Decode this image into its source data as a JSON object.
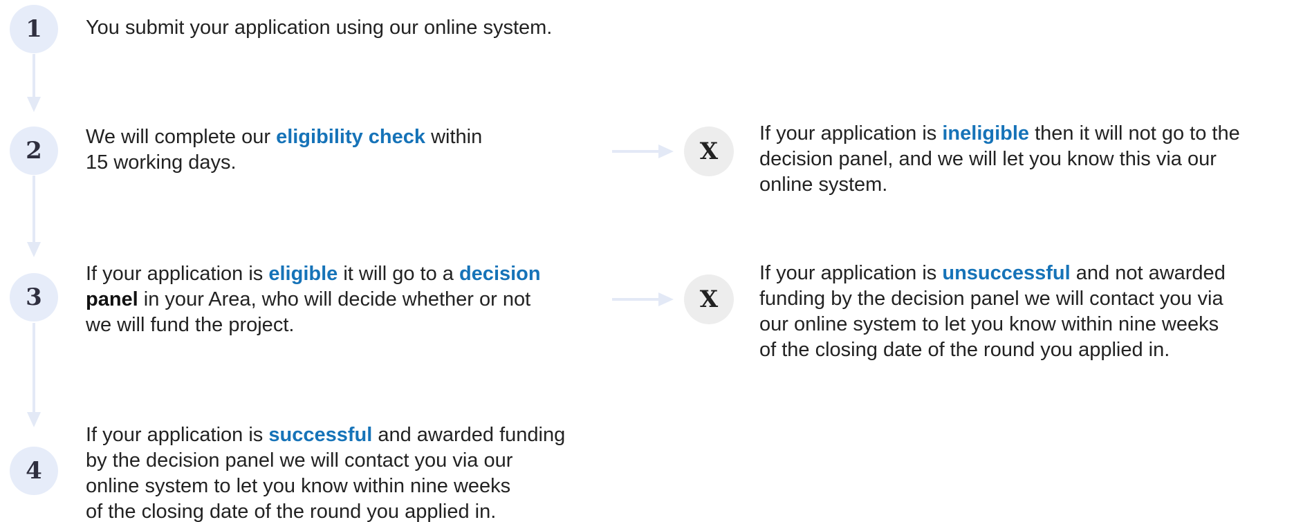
{
  "steps": [
    {
      "number": "1",
      "lines": [
        [
          {
            "t": "You submit your application using our online system.",
            "s": ""
          }
        ]
      ]
    },
    {
      "number": "2",
      "lines": [
        [
          {
            "t": "We will complete our ",
            "s": ""
          },
          {
            "t": "eligibility check",
            "s": "blue"
          },
          {
            "t": " within",
            "s": ""
          }
        ],
        [
          {
            "t": "15 working days.",
            "s": ""
          }
        ]
      ]
    },
    {
      "number": "3",
      "lines": [
        [
          {
            "t": "If your application is ",
            "s": ""
          },
          {
            "t": "eligible",
            "s": "blue"
          },
          {
            "t": " it will go to a ",
            "s": ""
          },
          {
            "t": "decision",
            "s": "blue"
          }
        ],
        [
          {
            "t": "panel",
            "s": "bold"
          },
          {
            "t": " in your Area, who will decide whether or not",
            "s": ""
          }
        ],
        [
          {
            "t": "we will fund the project.",
            "s": ""
          }
        ]
      ]
    },
    {
      "number": "4",
      "lines": [
        [
          {
            "t": "If your application is ",
            "s": ""
          },
          {
            "t": "successful",
            "s": "blue"
          },
          {
            "t": " and awarded funding",
            "s": ""
          }
        ],
        [
          {
            "t": "by the decision panel we will contact you via our",
            "s": ""
          }
        ],
        [
          {
            "t": "online system to let you know within nine weeks",
            "s": ""
          }
        ],
        [
          {
            "t": "of the closing date of the round you applied in.",
            "s": ""
          }
        ]
      ]
    }
  ],
  "outcomes": [
    {
      "symbol": "X",
      "lines": [
        [
          {
            "t": "If your application is ",
            "s": ""
          },
          {
            "t": "ineligible",
            "s": "blue"
          },
          {
            "t": " then it will not go to the",
            "s": ""
          }
        ],
        [
          {
            "t": "decision panel, and we will let you know this via our",
            "s": ""
          }
        ],
        [
          {
            "t": "online system.",
            "s": ""
          }
        ]
      ]
    },
    {
      "symbol": "X",
      "lines": [
        [
          {
            "t": "If your application is ",
            "s": ""
          },
          {
            "t": "unsuccessful",
            "s": "blue"
          },
          {
            "t": " and not awarded",
            "s": ""
          }
        ],
        [
          {
            "t": "funding by the decision panel we will contact you via",
            "s": ""
          }
        ],
        [
          {
            "t": "our online system to let you know within nine weeks",
            "s": ""
          }
        ],
        [
          {
            "t": "of the closing date of the round you applied in.",
            "s": ""
          }
        ]
      ]
    }
  ],
  "colors": {
    "highlight": "#1673b8",
    "step_circle": "#e6ecf9",
    "outcome_circle": "#ededed",
    "connector": "#e3e9f6"
  }
}
